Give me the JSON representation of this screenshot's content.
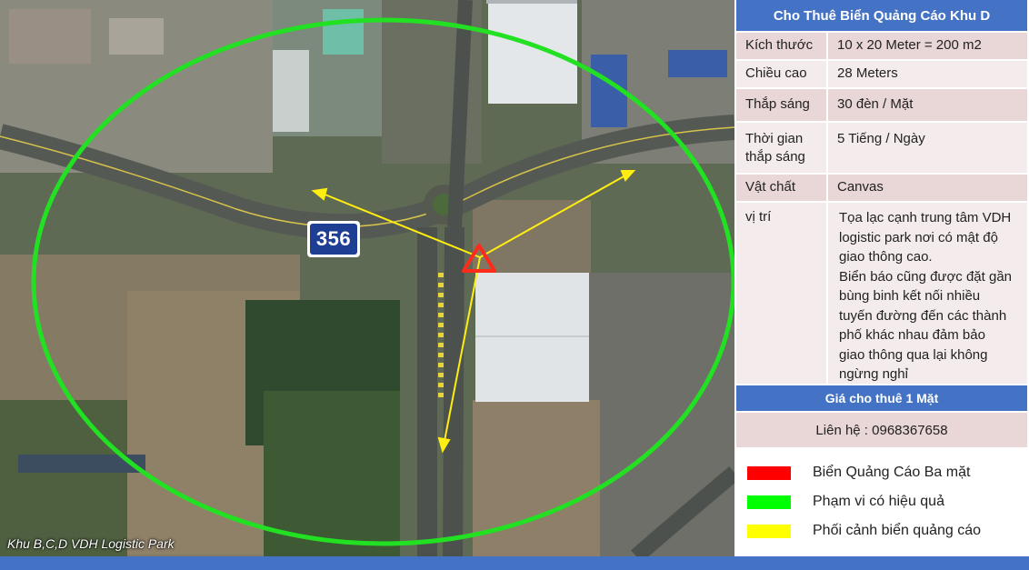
{
  "map": {
    "caption": "Khu B,C,D VDH Logistic Park",
    "route_number": "356",
    "colors": {
      "coverage_ellipse": "#22e022",
      "view_arrows": "#ffee10",
      "billboard_marker": "#ff2a1a"
    }
  },
  "panel": {
    "title": "Cho Thuê Biển Quảng Cáo Khu D",
    "specs": [
      {
        "label": "Kích thước",
        "value": "10 x 20 Meter = 200 m2"
      },
      {
        "label": "Chiều cao",
        "value": "28 Meters"
      },
      {
        "label": "Thắp sáng",
        "value": "30 đèn / Mặt"
      },
      {
        "label": "Thời gian thắp sáng",
        "value": "5 Tiếng / Ngày"
      },
      {
        "label": "Vật chất",
        "value": "Canvas"
      },
      {
        "label": "vị trí",
        "value_lines": [
          "Tọa lạc cạnh trung tâm VDH",
          "logistic park nơi có mật độ",
          "giao thông cao.",
          "Biển báo cũng được đặt gần",
          "bùng binh kết nối nhiều",
          "tuyến đường đến các thành",
          "phố khác nhau đảm bảo",
          "giao thông qua lại không",
          "ngừng nghỉ"
        ]
      }
    ],
    "price_label": "Giá cho thuê 1 Mặt",
    "contact": "Liên hệ : 0968367658"
  },
  "legend": [
    {
      "label": "Biển Quảng Cáo Ba mặt",
      "color": "#ff0000"
    },
    {
      "label": "Phạm vi có hiệu quả",
      "color": "#00ff00"
    },
    {
      "label": "Phối cảnh biển quảng cáo",
      "color": "#ffff00"
    }
  ],
  "accent_color": "#4472c4"
}
